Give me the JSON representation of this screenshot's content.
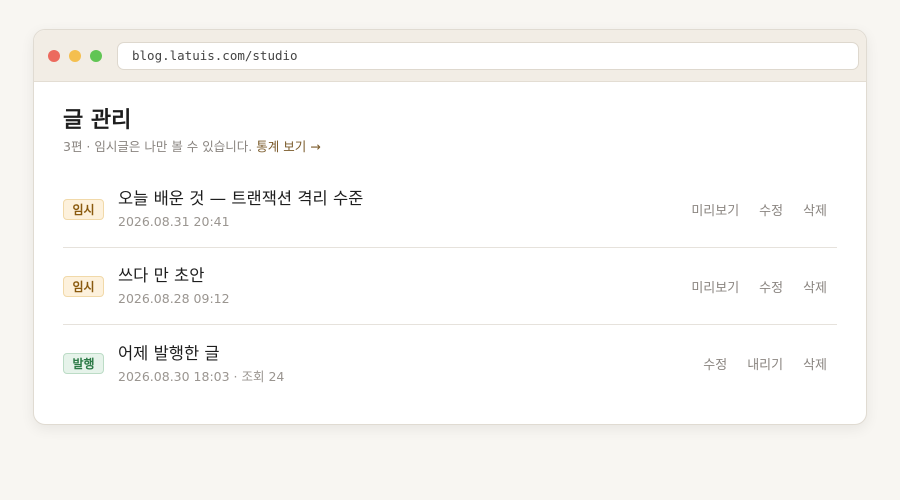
{
  "browser": {
    "url": "blog.latuis.com/studio",
    "dots": [
      "#ec6a5e",
      "#f4bf4f",
      "#61c554"
    ]
  },
  "page": {
    "title": "글 관리",
    "summary": "3편 · 임시글은 나만 볼 수 있습니다.",
    "stats_link": "통계 보기 →"
  },
  "posts": [
    {
      "status": "임시",
      "status_type": "draft",
      "title": "오늘 배운 것 — 트랜잭션 격리 수준",
      "meta": "2026.08.31 20:41",
      "actions": [
        "미리보기",
        "수정",
        "삭제"
      ]
    },
    {
      "status": "임시",
      "status_type": "draft",
      "title": "쓰다 만 초안",
      "meta": "2026.08.28 09:12",
      "actions": [
        "미리보기",
        "수정",
        "삭제"
      ]
    },
    {
      "status": "발행",
      "status_type": "published",
      "title": "어제 발행한 글",
      "meta": "2026.08.30 18:03 · 조회 24",
      "actions": [
        "수정",
        "내리기",
        "삭제"
      ]
    }
  ]
}
